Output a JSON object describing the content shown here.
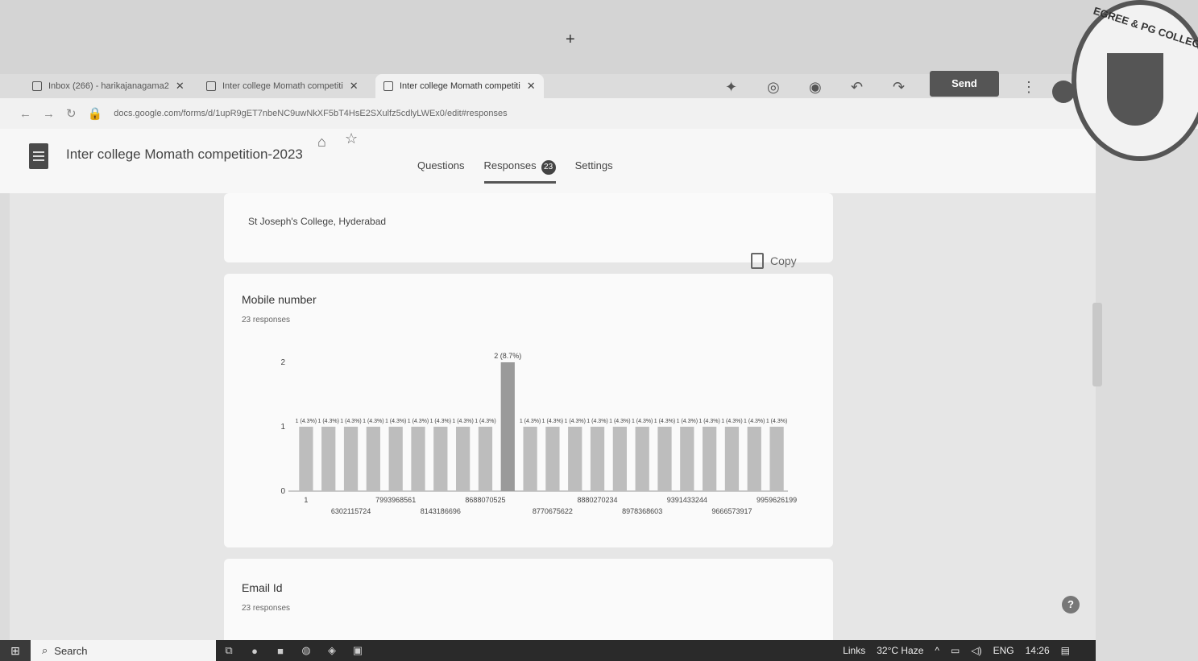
{
  "browser": {
    "tabs": [
      {
        "label": "Inbox (266) - harikajanagama2",
        "active": false
      },
      {
        "label": "Inter college Momath competiti",
        "active": false
      },
      {
        "label": "Inter college Momath competiti",
        "active": true
      }
    ],
    "new_tab": "+",
    "url": "docs.google.com/forms/d/1upR9gET7nbeNC9uwNkXF5bT4HsE2SXulfz5cdlyLWEx0/edit#responses"
  },
  "forms": {
    "title": "Inter college Momath competition-2023",
    "tabs": [
      {
        "label": "Questions"
      },
      {
        "label": "Responses",
        "badge": "23",
        "selected": true
      },
      {
        "label": "Settings"
      }
    ],
    "send_label": "Send"
  },
  "prev_answer": "St Joseph's College, Hyderabad",
  "question": {
    "title": "Mobile number",
    "responses": "23 responses",
    "copy_label": "Copy"
  },
  "next_question": {
    "title": "Email Id",
    "responses": "23 responses"
  },
  "chart_data": {
    "type": "bar",
    "ylim": [
      0,
      2
    ],
    "yticks": [
      0,
      1,
      2
    ],
    "color": "#bdbdbd",
    "highlight_color": "#9a9a9a",
    "values": [
      1,
      1,
      1,
      1,
      1,
      1,
      1,
      1,
      1,
      2,
      1,
      1,
      1,
      1,
      1,
      1,
      1,
      1,
      1,
      1,
      1,
      1
    ],
    "data_labels": [
      "1 (4.3%)",
      "1 (4.3%)",
      "1 (4.3%)",
      "1 (4.3%)",
      "1 (4.3%)",
      "1 (4.3%)",
      "1 (4.3%)",
      "1 (4.3%)",
      "1 (4.3%)",
      "2 (8.7%)",
      "1 (4.3%)",
      "1 (4.3%)",
      "1 (4.3%)",
      "1 (4.3%)",
      "1 (4.3%)",
      "1 (4.3%)",
      "1 (4.3%)",
      "1 (4.3%)",
      "1 (4.3%)",
      "1 (4.3%)",
      "1 (4.3%)",
      "1 (4.3%)"
    ],
    "x_labels_row1": [
      "1",
      "7993968561",
      "8688070525",
      "8880270234",
      "9391433244",
      "9959626199"
    ],
    "x_labels_row2": [
      "6302115724",
      "8143186696",
      "8770675622",
      "8978368603",
      "9666573917"
    ]
  },
  "taskbar": {
    "search_label": "Search",
    "links_label": "Links",
    "weather": "32°C Haze",
    "language": "ENG",
    "time": "14:26"
  },
  "seal": {
    "text": "EGREE & PG COLLEGE"
  }
}
